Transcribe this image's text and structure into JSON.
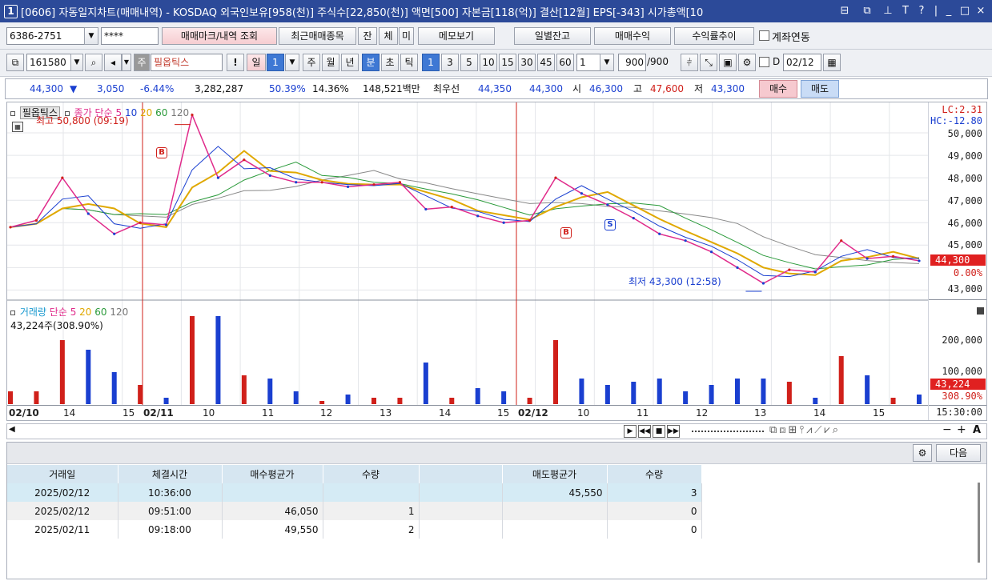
{
  "window": {
    "screen_number": "1",
    "title": "[0606] 자동일지차트(매매내역) - KOSDAQ 외국인보유[958(천)] 주식수[22,850(천)] 액면[500] 자본금[118(억)] 결산[12월] EPS[-343] 시가총액[10",
    "controls": [
      "⊟",
      "⧉",
      "⊥",
      "T",
      "?",
      "|",
      "_",
      "□",
      "×"
    ]
  },
  "toolbar1": {
    "account": "6386-2751",
    "password": "****",
    "btn_trade_mark": "매매마크/내역 조회",
    "btn_recent": "최근매매종목",
    "btn_jan": "잔",
    "btn_che": "체",
    "btn_mi": "미",
    "btn_memo": "메모보기",
    "btn_daily_balance": "일별잔고",
    "btn_profit": "매매수익",
    "btn_yield": "수익률추이",
    "link_label": "계좌연동"
  },
  "toolbar2": {
    "code": "161580",
    "ju": "주",
    "stock_name": "필옵틱스",
    "excl": "!",
    "period_il": "일",
    "period_il_n": "1",
    "periods": [
      "주",
      "월",
      "년"
    ],
    "unit_min": "분",
    "unit_cho": "초",
    "unit_tick": "틱",
    "intervals": [
      "1",
      "3",
      "5",
      "10",
      "15",
      "30",
      "45",
      "60"
    ],
    "count_select": "1",
    "count_value": "900",
    "count_total": "/900",
    "d_label": "D",
    "date": "02/12"
  },
  "quote": {
    "price": "44,300",
    "arrow": "▼",
    "change": "3,050",
    "rate": "-6.44%",
    "volume": "3,282,287",
    "vol_rate": "50.39%",
    "turnover": "14.36%",
    "amount": "148,521백만",
    "best_ask_label": "최우선",
    "best_ask": "44,350",
    "best_bid": "44,300",
    "open_label": "시",
    "open": "46,300",
    "high_label": "고",
    "high": "47,600",
    "low_label": "저",
    "low": "43,300",
    "buy_btn": "매수",
    "sell_btn": "매도"
  },
  "price_panel": {
    "stock_tag": "필옵틱스",
    "legend_title": "종가 단순",
    "ma": [
      "5",
      "10",
      "20",
      "60",
      "120"
    ],
    "max_label": "최고 50,800 (09:19)",
    "min_label": "최저 43,300 (12:58)",
    "lc": "LC:2.31",
    "hc": "HC:-12.80",
    "y_labels": [
      "50,000",
      "49,000",
      "48,000",
      "47,000",
      "46,000",
      "45,000",
      "0.00%",
      "43,000"
    ],
    "current_price_tag": "44,300",
    "buy_mark": "B",
    "sell_mark": "S"
  },
  "volume_panel": {
    "legend_title": "거래량",
    "legend_ma": "단순",
    "ma": [
      "5",
      "20",
      "60",
      "120"
    ],
    "current_label": "43,224주(308.90%)",
    "y_labels": [
      "200,000",
      "100,000"
    ],
    "current_tag": "43,224",
    "current_pct": "308.90%"
  },
  "time_axis": [
    "02/10",
    "14",
    "15",
    "02/11",
    "10",
    "11",
    "12",
    "13",
    "14",
    "15",
    "02/12",
    "10",
    "11",
    "12",
    "13",
    "14",
    "15"
  ],
  "time_axis_right": "15:30:00",
  "chart_data": {
    "type": "line",
    "title": "",
    "xlabel": "",
    "ylabel": "",
    "ylim": [
      42800,
      51000
    ],
    "x": [
      "02/10 13:40",
      "02/10 14:00",
      "02/10 14:20",
      "02/10 14:40",
      "02/10 15:00",
      "02/10 15:20",
      "02/11 09:05",
      "02/11 09:19",
      "02/11 09:40",
      "02/11 10:00",
      "02/11 10:30",
      "02/11 11:00",
      "02/11 11:30",
      "02/11 12:00",
      "02/11 12:30",
      "02/11 13:00",
      "02/11 13:30",
      "02/11 14:00",
      "02/11 14:30",
      "02/11 15:00",
      "02/11 15:20",
      "02/12 09:10",
      "02/12 09:30",
      "02/12 10:00",
      "02/12 10:30",
      "02/12 11:00",
      "02/12 11:30",
      "02/12 12:00",
      "02/12 12:30",
      "02/12 12:58",
      "02/12 13:30",
      "02/12 14:00",
      "02/12 14:20",
      "02/12 14:40",
      "02/12 15:00",
      "02/12 15:20"
    ],
    "series": [
      {
        "values": [
          45800,
          46100,
          48000,
          46400,
          45500,
          46000,
          45900,
          50800,
          48000,
          48800,
          48100,
          47800,
          47800,
          47600,
          47700,
          47800,
          46600,
          46700,
          46300,
          46000,
          46100,
          48000,
          47300,
          46800,
          46200,
          45500,
          45200,
          44700,
          44000,
          43300,
          43900,
          43800,
          45200,
          44400,
          44500,
          44300
        ]
      }
    ]
  },
  "table": {
    "headers": [
      "거래일",
      "체결시간",
      "매수평균가",
      "수량",
      "",
      "매도평균가",
      "수량"
    ],
    "rows": [
      [
        "2025/02/12",
        "10:36:00",
        "",
        "",
        "",
        "45,550",
        "3"
      ],
      [
        "2025/02/12",
        "09:51:00",
        "46,050",
        "1",
        "",
        "",
        "0"
      ],
      [
        "2025/02/11",
        "09:18:00",
        "49,550",
        "2",
        "",
        "",
        "0"
      ]
    ],
    "next_btn": "다음"
  }
}
